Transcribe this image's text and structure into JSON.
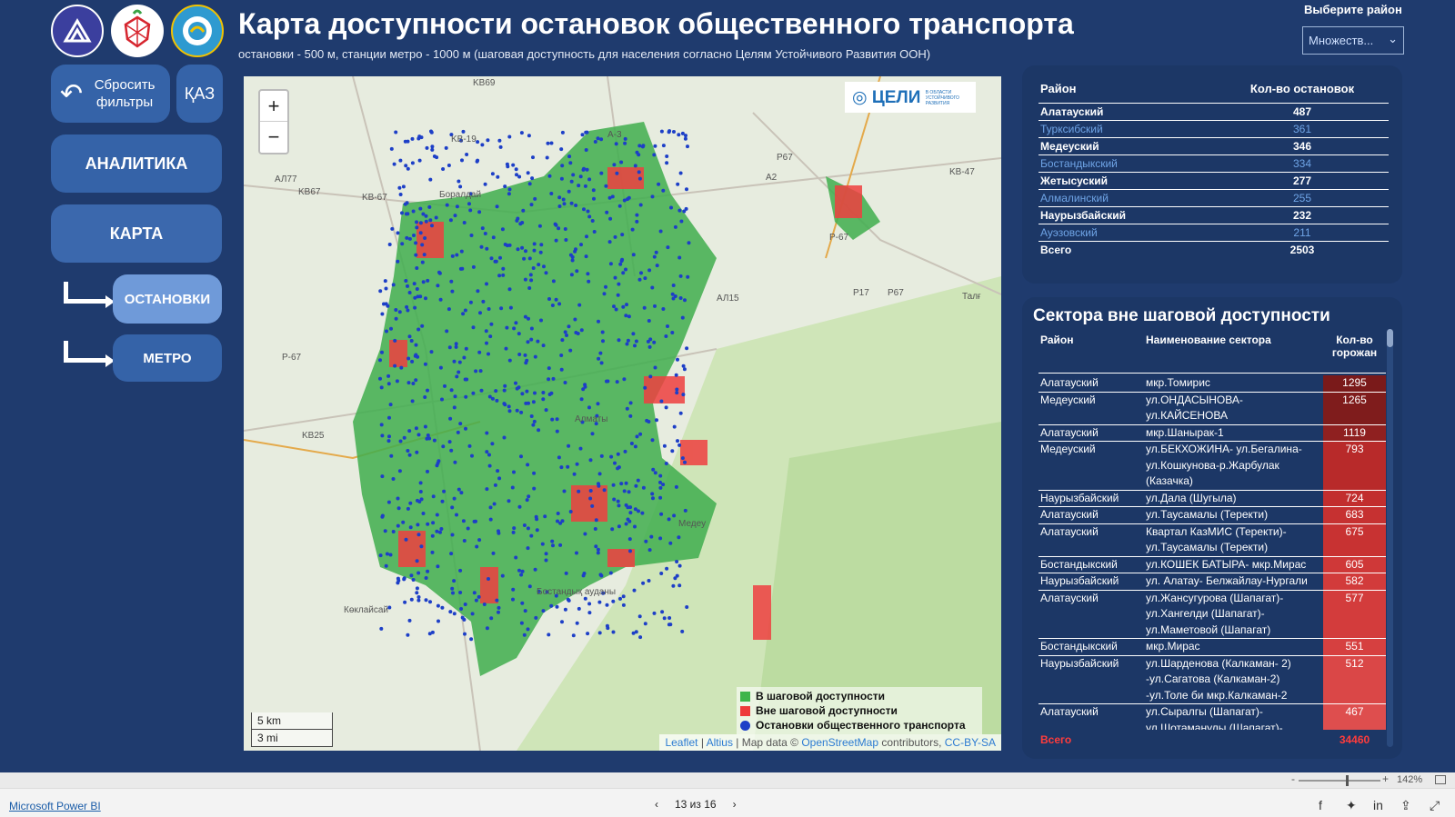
{
  "header": {
    "title": "Карта доступности остановок общественного транспорта",
    "subtitle": "остановки - 500 м, станции метро - 1000 м (шаговая доступность для населения согласно Целям Устойчивого Развития ООН)"
  },
  "filter": {
    "label": "Выберите район",
    "value": "Множеств..."
  },
  "nav": {
    "reset": "Сбросить фильтры",
    "lang": "ҚАЗ",
    "analytics": "АНАЛИТИКА",
    "map": "КАРТА",
    "stops": "ОСТАНОВКИ",
    "metro": "МЕТРО"
  },
  "map": {
    "logo_text": "ЦЕЛИ",
    "logo_sub": "В ОБЛАСТИ УСТОЙЧИВОГО РАЗВИТИЯ",
    "legend": [
      {
        "label": "В шаговой доступности",
        "color": "#3db54a"
      },
      {
        "label": "Вне шаговой доступности",
        "color": "#ee3a3a"
      },
      {
        "label": "Остановки общественного транспорта",
        "color": "#1d3fc7"
      }
    ],
    "scale_km": "5 km",
    "scale_mi": "3 mi",
    "attribution": {
      "leaflet": "Leaflet",
      "altius": "Altius",
      "map_data": "| Map data ©",
      "osm": "OpenStreetMap",
      "contributors": "contributors,",
      "license": "CC-BY-SA"
    },
    "place_labels": [
      "KB69",
      "KB-19",
      "A-3",
      "Боралдай",
      "KB-67",
      "АЛ77",
      "KB67",
      "P67",
      "A2",
      "KB-47",
      "P-67",
      "Медеу",
      "Бостандық ауданы",
      "Көклайсай",
      "P-67",
      "АЛ15",
      "P17",
      "P67",
      "Талғ",
      "Алматы",
      "KB25"
    ]
  },
  "stops_table": {
    "headers": [
      "Район",
      "Кол-во остановок"
    ],
    "rows": [
      {
        "district": "Алатауский",
        "count": "487"
      },
      {
        "district": "Турксибский",
        "count": "361"
      },
      {
        "district": "Медеуский",
        "count": "346"
      },
      {
        "district": "Бостандыкский",
        "count": "334"
      },
      {
        "district": "Жетысуский",
        "count": "277"
      },
      {
        "district": "Алмалинский",
        "count": "255"
      },
      {
        "district": "Наурызбайский",
        "count": "232"
      },
      {
        "district": "Ауэзовский",
        "count": "211"
      }
    ],
    "total_label": "Всего",
    "total": "2503"
  },
  "sectors_table": {
    "title": "Сектора вне шаговой доступности",
    "headers": [
      "Район",
      "Наименование сектора",
      "Кол-во горожан"
    ],
    "rows": [
      {
        "district": "Алатауский",
        "sector": "мкр.Томирис",
        "count": "1295",
        "color": "#7a1a1a"
      },
      {
        "district": "Медеуский",
        "sector": "ул.ОНДАСЫНОВА-ул.КАЙСЕНОВА",
        "count": "1265",
        "color": "#7f1c1c"
      },
      {
        "district": "Алатауский",
        "sector": "мкр.Шанырак-1",
        "count": "1119",
        "color": "#8f2020"
      },
      {
        "district": "Медеуский",
        "sector": "ул.БЕКХОЖИНА- ул.Бегалина-ул.Кошкунова-р.Жарбулак (Казачка)",
        "count": "793",
        "color": "#b82a2a"
      },
      {
        "district": "Наурызбайский",
        "sector": "ул.Дала (Шугыла)",
        "count": "724",
        "color": "#c22e2e"
      },
      {
        "district": "Алатауский",
        "sector": "ул.Таусамалы (Теректи)",
        "count": "683",
        "color": "#c63131"
      },
      {
        "district": "Алатауский",
        "sector": "Квартал КазМИС (Теректи)-ул.Таусамалы (Теректи)",
        "count": "675",
        "color": "#c83232"
      },
      {
        "district": "Бостандыкский",
        "sector": "ул.КОШЕК БАТЫРА- мкр.Мирас",
        "count": "605",
        "color": "#cf3838"
      },
      {
        "district": "Наурызбайский",
        "sector": "ул. Алатау- Белжайлау-Нургали",
        "count": "582",
        "color": "#d23b3b"
      },
      {
        "district": "Алатауский",
        "sector": "ул.Жансугурова (Шапагат)-ул.Хангелди (Шапагат)-ул.Маметовой (Шапагат)",
        "count": "577",
        "color": "#d33c3c"
      },
      {
        "district": "Бостандыкский",
        "sector": "мкр.Мирас",
        "count": "551",
        "color": "#d64040"
      },
      {
        "district": "Наурызбайский",
        "sector": "ул.Шарденова (Калкаман- 2) -ул.Сагатова (Калкаман-2) -ул.Толе би мкр.Калкаман-2",
        "count": "512",
        "color": "#da4747"
      },
      {
        "district": "Алатауский",
        "sector": "ул.Сыралгы (Шапагат)-ул.Шотаманулы (Шапагат)-",
        "count": "467",
        "color": "#de4e4e"
      }
    ],
    "total_label": "Всего",
    "total": "34460"
  },
  "pbi": {
    "brand": "Microsoft Power BI",
    "page": "13 из 16",
    "zoom": "142%",
    "zoom_minus": "-",
    "zoom_plus": "+",
    "prev": "‹",
    "next": "›"
  }
}
